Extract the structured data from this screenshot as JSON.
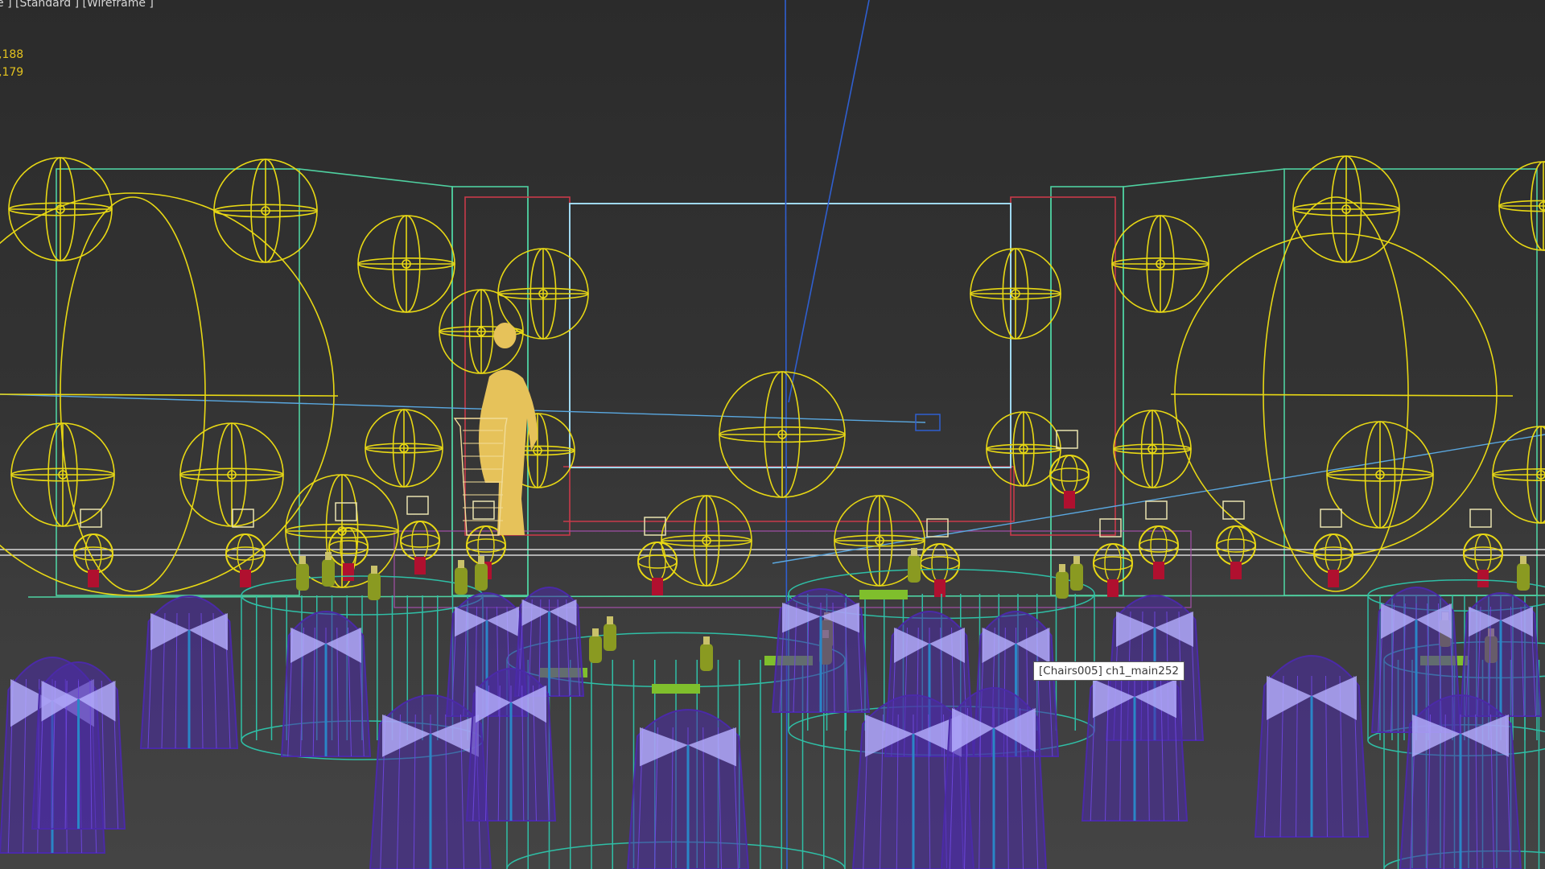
{
  "viewport": {
    "label": "e ] [Standard ] [Wireframe ]",
    "stats": [
      ",188",
      ",179"
    ],
    "tooltip": "[Chairs005] ch1_main252",
    "colors": {
      "background": "#353535",
      "wall_wire": "#4fd1a1",
      "sphere_wire": "#e8d814",
      "chair_cover": "#4b2aa8",
      "chair_bow": "#b7b0ff",
      "table_wire": "#2fbfa6",
      "stage_frame": "#c83a4a",
      "screen_frame": "#9fd8f0",
      "person": "#e6c25a",
      "axis_line": "#2f5fd0",
      "status_text": "#e3c21f"
    },
    "icons": [
      "person-silhouette-icon",
      "sphere-light-icon",
      "chair-icon",
      "table-icon"
    ]
  }
}
